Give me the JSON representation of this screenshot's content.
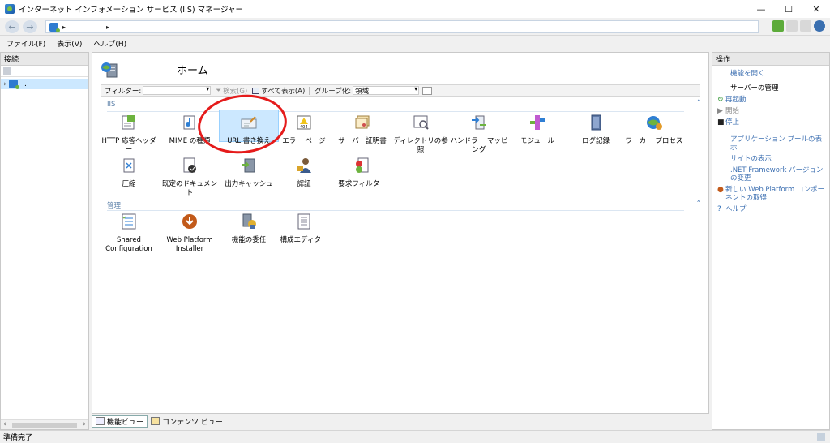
{
  "window": {
    "title": "インターネット インフォメーション サービス (IIS) マネージャー",
    "controls": {
      "minimize": "—",
      "maximize": "☐",
      "close": "✕"
    }
  },
  "address": {
    "back": "←",
    "forward": "→",
    "separator": "▸"
  },
  "menu": [
    "ファイル(F)",
    "表示(V)",
    "ヘルプ(H)"
  ],
  "connections": {
    "header": "接続",
    "tree": [
      {
        "label": ".",
        "expander": "›"
      }
    ]
  },
  "center": {
    "page_title": "ホーム",
    "filter": {
      "label": "フィルター:",
      "search": "検索(G)",
      "show_all": "すべて表示(A)",
      "group_label": "グループ化:",
      "group_value": "領域"
    },
    "sections": [
      {
        "name": "IIS",
        "items": [
          {
            "label": "HTTP 応答ヘッダー",
            "icon": "http-headers-icon"
          },
          {
            "label": "MIME の種類",
            "icon": "mime-types-icon"
          },
          {
            "label": "URL 書き換え",
            "icon": "url-rewrite-icon",
            "selected": true
          },
          {
            "label": "エラー ページ",
            "icon": "error-pages-icon"
          },
          {
            "label": "サーバー証明書",
            "icon": "server-certificates-icon"
          },
          {
            "label": "ディレクトリの参照",
            "icon": "directory-browsing-icon"
          },
          {
            "label": "ハンドラー マッピング",
            "icon": "handler-mappings-icon"
          },
          {
            "label": "モジュール",
            "icon": "modules-icon"
          },
          {
            "label": "ログ記録",
            "icon": "logging-icon"
          },
          {
            "label": "ワーカー プロセス",
            "icon": "worker-processes-icon"
          },
          {
            "label": "圧縮",
            "icon": "compression-icon"
          },
          {
            "label": "既定のドキュメント",
            "icon": "default-document-icon"
          },
          {
            "label": "出力キャッシュ",
            "icon": "output-caching-icon"
          },
          {
            "label": "認証",
            "icon": "authentication-icon"
          },
          {
            "label": "要求フィルター",
            "icon": "request-filtering-icon"
          }
        ]
      },
      {
        "name": "管理",
        "items": [
          {
            "label": "Shared Configuration",
            "icon": "shared-configuration-icon"
          },
          {
            "label": "Web Platform Installer",
            "icon": "web-platform-installer-icon"
          },
          {
            "label": "機能の委任",
            "icon": "feature-delegation-icon"
          },
          {
            "label": "構成エディター",
            "icon": "configuration-editor-icon"
          }
        ]
      }
    ],
    "collapse_glyph": "˄"
  },
  "view_tabs": [
    {
      "label": "機能ビュー",
      "active": true
    },
    {
      "label": "コンテンツ ビュー",
      "active": false
    }
  ],
  "actions": {
    "header": "操作",
    "open_feature": "機能を開く",
    "server_manage": "サーバーの管理",
    "restart": "再起動",
    "start": "開始",
    "stop": "停止",
    "view_app_pools": "アプリケーション プールの表示",
    "view_sites": "サイトの表示",
    "change_framework": ".NET Framework バージョンの変更",
    "get_new_components": "新しい Web Platform コンポーネントの取得",
    "help": "ヘルプ"
  },
  "status": {
    "text": "準備完了"
  },
  "colors": {
    "selection": "#cce8ff",
    "link": "#3c6fb1",
    "annotation": "#e51b1b"
  }
}
